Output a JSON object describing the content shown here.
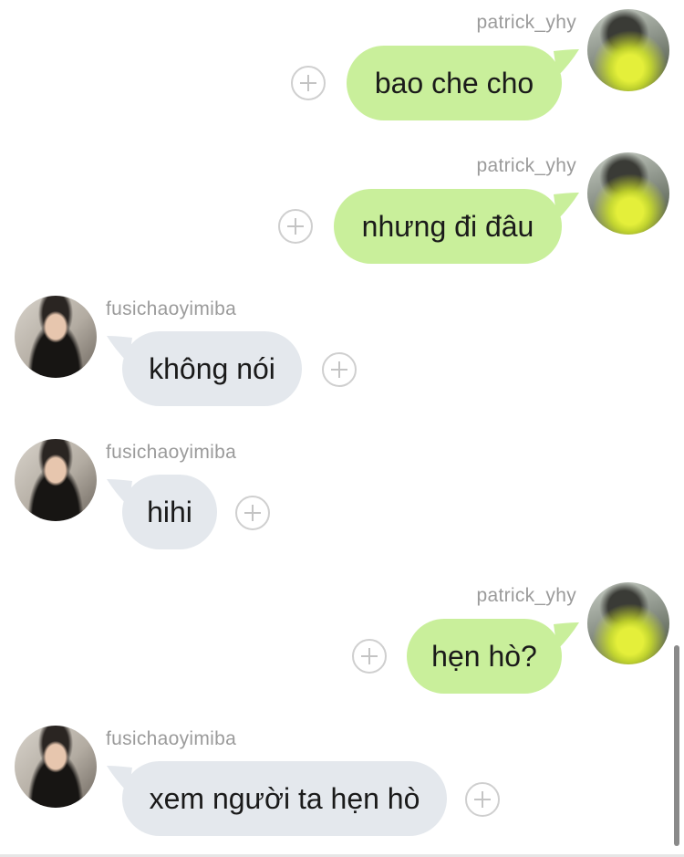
{
  "conversation": {
    "messages": [
      {
        "sender": "patrick_yhy",
        "direction": "outgoing",
        "text": "bao che cho"
      },
      {
        "sender": "patrick_yhy",
        "direction": "outgoing",
        "text": "nhưng đi đâu"
      },
      {
        "sender": "fusichaoyimiba",
        "direction": "incoming",
        "text": "không nói"
      },
      {
        "sender": "fusichaoyimiba",
        "direction": "incoming",
        "text": "hihi"
      },
      {
        "sender": "patrick_yhy",
        "direction": "outgoing",
        "text": "hẹn hò?"
      },
      {
        "sender": "fusichaoyimiba",
        "direction": "incoming",
        "text": "xem người ta hẹn hò"
      }
    ]
  },
  "colors": {
    "outgoing_bubble": "#c9ef9b",
    "incoming_bubble": "#e4e8ed",
    "username_text": "#9b9b9b"
  },
  "icons": {
    "react_button": "plus-circle-icon"
  }
}
